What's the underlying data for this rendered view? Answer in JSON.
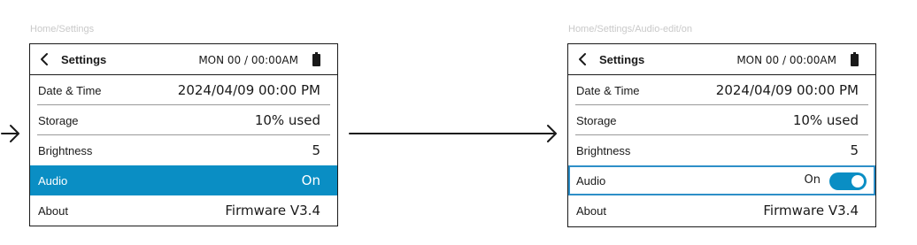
{
  "left_screen": {
    "breadcrumb": "Home/Settings",
    "header": {
      "title": "Settings",
      "clock": "MON 00 / 00:00AM"
    },
    "rows": [
      {
        "label": "Date & Time",
        "value": "2024/04/09 00:00 PM"
      },
      {
        "label": "Storage",
        "value": "10% used"
      },
      {
        "label": "Brightness",
        "value": "5"
      },
      {
        "label": "Audio",
        "value": "On"
      },
      {
        "label": "About",
        "value": "Firmware V3.4"
      }
    ],
    "highlighted_row": "Audio"
  },
  "right_screen": {
    "breadcrumb": "Home/Settings/Audio-edit/on",
    "header": {
      "title": "Settings",
      "clock": "MON 00 / 00:00AM"
    },
    "rows": [
      {
        "label": "Date & Time",
        "value": "2024/04/09 00:00 PM"
      },
      {
        "label": "Storage",
        "value": "10% used"
      },
      {
        "label": "Brightness",
        "value": "5"
      },
      {
        "label": "Audio",
        "value": "On",
        "toggle_state": "on"
      },
      {
        "label": "About",
        "value": "Firmware V3.4"
      }
    ],
    "editing_row": "Audio"
  },
  "colors": {
    "highlight": "#0a8ec4",
    "edit_border": "#2e8fc8",
    "breadcrumb": "#c9c9c9"
  },
  "icons": [
    "chevron-left-icon",
    "battery-icon",
    "toggle-switch",
    "right-arrow-icon"
  ]
}
